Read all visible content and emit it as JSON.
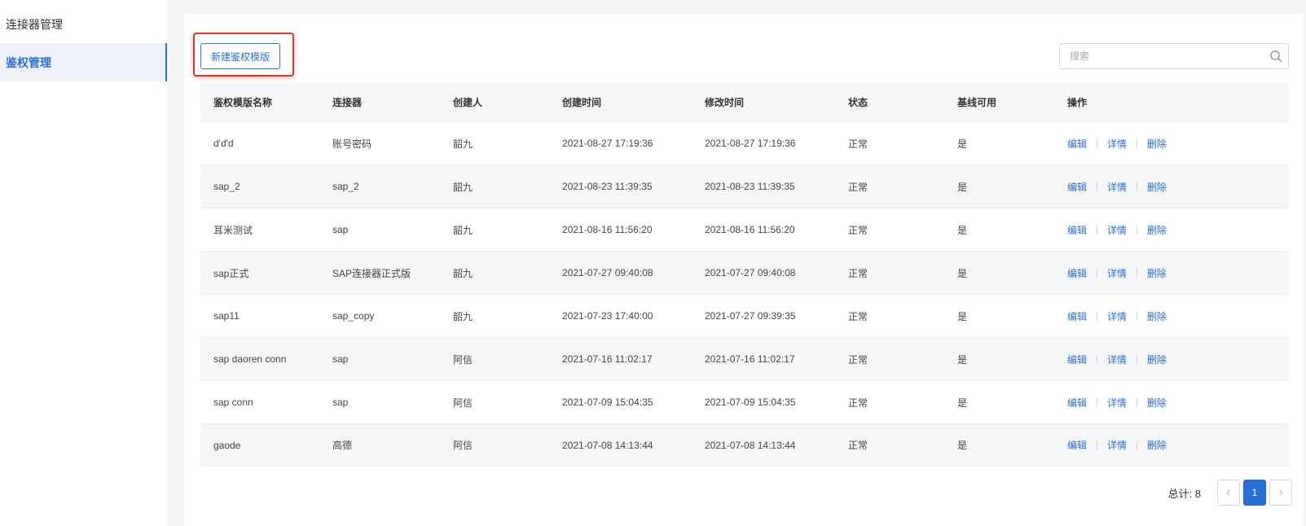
{
  "sidebar": {
    "items": [
      {
        "label": "连接器管理",
        "active": false
      },
      {
        "label": "鉴权管理",
        "active": true
      }
    ]
  },
  "toolbar": {
    "new_button_label": "新建鉴权模版",
    "search_placeholder": "搜索",
    "search_value": ""
  },
  "table": {
    "columns": [
      "鉴权模版名称",
      "连接器",
      "创建人",
      "创建时间",
      "修改时间",
      "状态",
      "基线可用",
      "操作"
    ],
    "rows": [
      {
        "name": "d'd'd",
        "connector": "账号密码",
        "creator": "韶九",
        "created": "2021-08-27 17:19:36",
        "modified": "2021-08-27 17:19:36",
        "status": "正常",
        "baseline": "是"
      },
      {
        "name": "sap_2",
        "connector": "sap_2",
        "creator": "韶九",
        "created": "2021-08-23 11:39:35",
        "modified": "2021-08-23 11:39:35",
        "status": "正常",
        "baseline": "是"
      },
      {
        "name": "耳米测试",
        "connector": "sap",
        "creator": "韶九",
        "created": "2021-08-16 11:56:20",
        "modified": "2021-08-16 11:56:20",
        "status": "正常",
        "baseline": "是"
      },
      {
        "name": "sap正式",
        "connector": "SAP连接器正式版",
        "creator": "韶九",
        "created": "2021-07-27 09:40:08",
        "modified": "2021-07-27 09:40:08",
        "status": "正常",
        "baseline": "是"
      },
      {
        "name": "sap11",
        "connector": "sap_copy",
        "creator": "韶九",
        "created": "2021-07-23 17:40:00",
        "modified": "2021-07-27 09:39:35",
        "status": "正常",
        "baseline": "是"
      },
      {
        "name": "sap daoren conn",
        "connector": "sap",
        "creator": "阿信",
        "created": "2021-07-16 11:02:17",
        "modified": "2021-07-16 11:02:17",
        "status": "正常",
        "baseline": "是"
      },
      {
        "name": "sap conn",
        "connector": "sap",
        "creator": "阿信",
        "created": "2021-07-09 15:04:35",
        "modified": "2021-07-09 15:04:35",
        "status": "正常",
        "baseline": "是"
      },
      {
        "name": "gaode",
        "connector": "高德",
        "creator": "阿信",
        "created": "2021-07-08 14:13:44",
        "modified": "2021-07-08 14:13:44",
        "status": "正常",
        "baseline": "是"
      }
    ],
    "actions": [
      "编辑",
      "详情",
      "删除"
    ],
    "action_separator": "|"
  },
  "pagination": {
    "total_label": "总计: 8",
    "current_page": "1",
    "prev_icon": "chevron-left-icon",
    "next_icon": "chevron-right-icon"
  },
  "colors": {
    "accent": "#2a6fd6",
    "highlight_box": "#d9392b"
  }
}
